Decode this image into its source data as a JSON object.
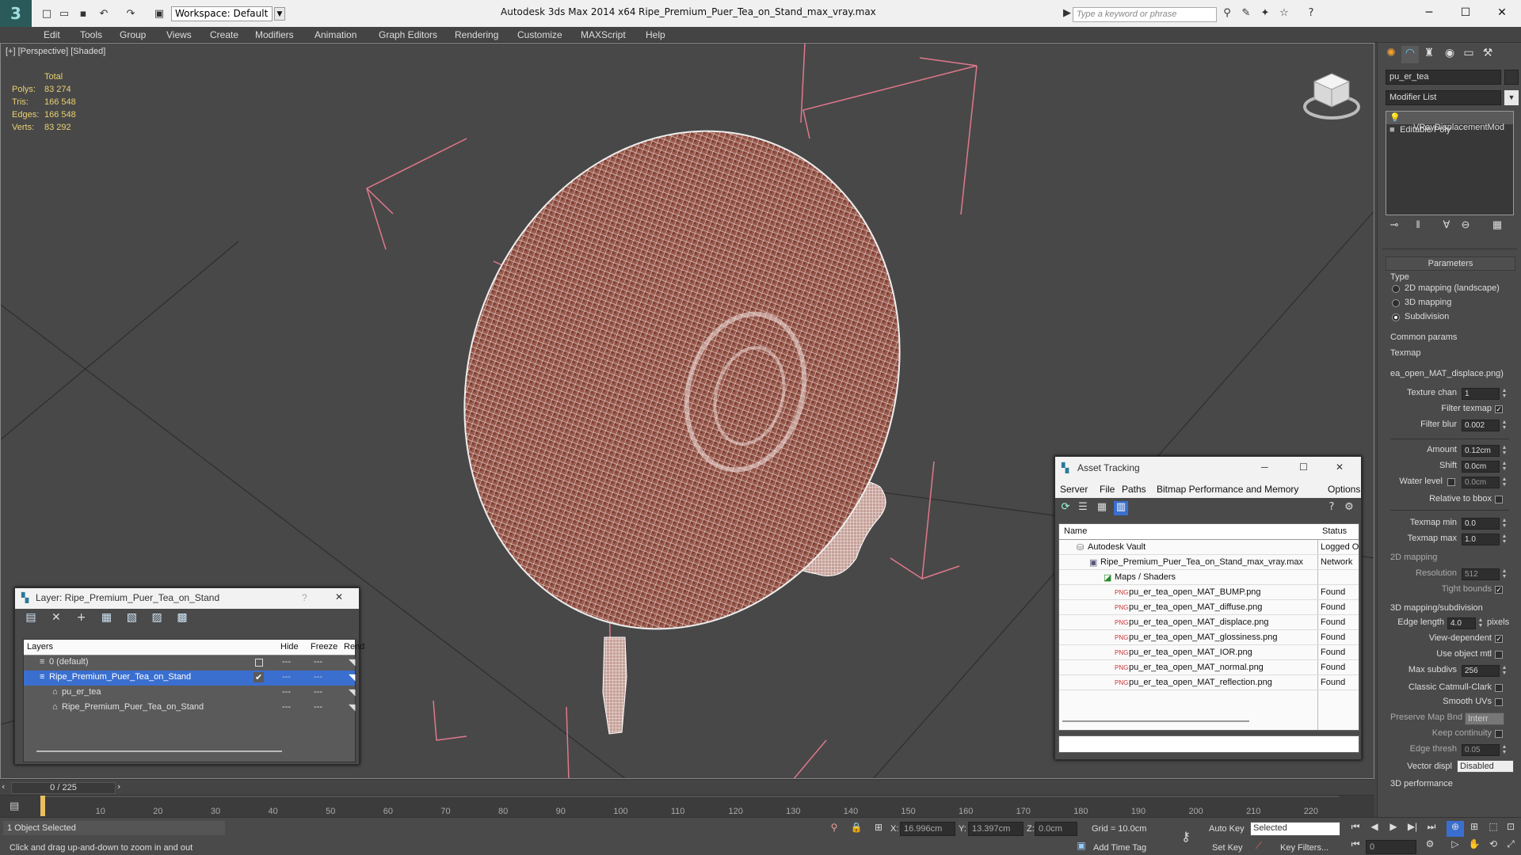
{
  "titlebar": {
    "workspace": "Workspace: Default",
    "app_title": "Autodesk 3ds Max  2014 x64",
    "file_title": "Ripe_Premium_Puer_Tea_on_Stand_max_vray.max",
    "search_placeholder": "Type a keyword or phrase"
  },
  "menu": [
    "Edit",
    "Tools",
    "Group",
    "Views",
    "Create",
    "Modifiers",
    "Animation",
    "Graph Editors",
    "Rendering",
    "Customize",
    "MAXScript",
    "Help"
  ],
  "viewport": {
    "label": "[+] [Perspective] [Shaded]",
    "stats": {
      "header": "Total",
      "rows": [
        {
          "label": "Polys:",
          "value": "83 274"
        },
        {
          "label": "Tris:",
          "value": "166 548"
        },
        {
          "label": "Edges:",
          "value": "166 548"
        },
        {
          "label": "Verts:",
          "value": "83 292"
        }
      ]
    }
  },
  "layer_dialog": {
    "title": "Layer: Ripe_Premium_Puer_Tea_on_Stand",
    "help": "?",
    "columns": {
      "layers": "Layers",
      "hide": "Hide",
      "freeze": "Freeze",
      "render": "Rend"
    },
    "rows": [
      {
        "name": "0 (default)"
      },
      {
        "name": "Ripe_Premium_Puer_Tea_on_Stand"
      },
      {
        "name": "pu_er_tea"
      },
      {
        "name": "Ripe_Premium_Puer_Tea_on_Stand"
      }
    ]
  },
  "asset_dialog": {
    "title": "Asset Tracking",
    "menu": [
      "Server",
      "File",
      "Paths",
      "Bitmap Performance and Memory",
      "Options"
    ],
    "columns": {
      "name": "Name",
      "status": "Status"
    },
    "rows": [
      {
        "name": "Autodesk Vault",
        "status": "Logged O"
      },
      {
        "name": "Ripe_Premium_Puer_Tea_on_Stand_max_vray.max",
        "status": "Network"
      },
      {
        "name": "Maps / Shaders",
        "status": ""
      },
      {
        "name": "pu_er_tea_open_MAT_BUMP.png",
        "status": "Found"
      },
      {
        "name": "pu_er_tea_open_MAT_diffuse.png",
        "status": "Found"
      },
      {
        "name": "pu_er_tea_open_MAT_displace.png",
        "status": "Found"
      },
      {
        "name": "pu_er_tea_open_MAT_glossiness.png",
        "status": "Found"
      },
      {
        "name": "pu_er_tea_open_MAT_IOR.png",
        "status": "Found"
      },
      {
        "name": "pu_er_tea_open_MAT_normal.png",
        "status": "Found"
      },
      {
        "name": "pu_er_tea_open_MAT_reflection.png",
        "status": "Found"
      }
    ]
  },
  "command_panel": {
    "object_name": "pu_er_tea",
    "modifier_list": "Modifier List",
    "stack": [
      "VRayDisplacementMod",
      "Editable Poly"
    ],
    "rollout_title": "Parameters",
    "type_label": "Type",
    "type_options": [
      "2D mapping (landscape)",
      "3D mapping",
      "Subdivision"
    ],
    "common_params": "Common params",
    "texmap_label": "Texmap",
    "texmap_value": "ea_open_MAT_displace.png)",
    "texture_chan": {
      "label": "Texture chan",
      "value": "1"
    },
    "filter_texmap": "Filter texmap",
    "filter_blur": {
      "label": "Filter blur",
      "value": "0.002"
    },
    "amount": {
      "label": "Amount",
      "value": "0.12cm"
    },
    "shift": {
      "label": "Shift",
      "value": "0.0cm"
    },
    "water_level": {
      "label": "Water level",
      "value": "0.0cm"
    },
    "relative_bbox": "Relative to bbox",
    "texmap_min": {
      "label": "Texmap min",
      "value": "0.0"
    },
    "texmap_max": {
      "label": "Texmap max",
      "value": "1.0"
    },
    "mapping_2d": "2D mapping",
    "resolution": {
      "label": "Resolution",
      "value": "512"
    },
    "tight_bounds": "Tight bounds",
    "mapping_3d": "3D mapping/subdivision",
    "edge_length": {
      "label": "Edge length",
      "value": "4.0",
      "unit": "pixels"
    },
    "view_dependent": "View-dependent",
    "use_object_mtl": "Use object mtl",
    "max_subdivs": {
      "label": "Max subdivs",
      "value": "256"
    },
    "classic_catmull": "Classic Catmull-Clark",
    "smooth_uvs": "Smooth UVs",
    "preserve_map": {
      "label": "Preserve Map Bnd",
      "value": "Interr"
    },
    "keep_continuity": "Keep continuity",
    "edge_thresh": {
      "label": "Edge thresh",
      "value": "0.05"
    },
    "vector_displ": {
      "label": "Vector displ",
      "value": "Disabled"
    },
    "performance": "3D performance"
  },
  "timeline": {
    "slider": "0 / 225",
    "ticks": [
      "10",
      "20",
      "30",
      "40",
      "50",
      "60",
      "70",
      "80",
      "90",
      "100",
      "110",
      "120",
      "130",
      "140",
      "150",
      "160",
      "170",
      "180",
      "190",
      "200",
      "210",
      "220"
    ]
  },
  "status": {
    "selected": "1 Object Selected",
    "prompt": "Click and drag up-and-down to zoom in and out",
    "x_label": "X:",
    "x_value": "16.996cm",
    "y_label": "Y:",
    "y_value": "13.397cm",
    "z_label": "Z:",
    "z_value": "0.0cm",
    "grid": "Grid = 10.0cm",
    "add_time_tag": "Add Time Tag",
    "auto_key": "Auto Key",
    "set_key": "Set Key",
    "selected_dropdown": "Selected",
    "key_filters": "Key Filters...",
    "frame": "0"
  },
  "colors": {
    "stats_text": "#e8d070",
    "bbox_lines": "#e0788c",
    "selection": "#3a6fd0"
  }
}
